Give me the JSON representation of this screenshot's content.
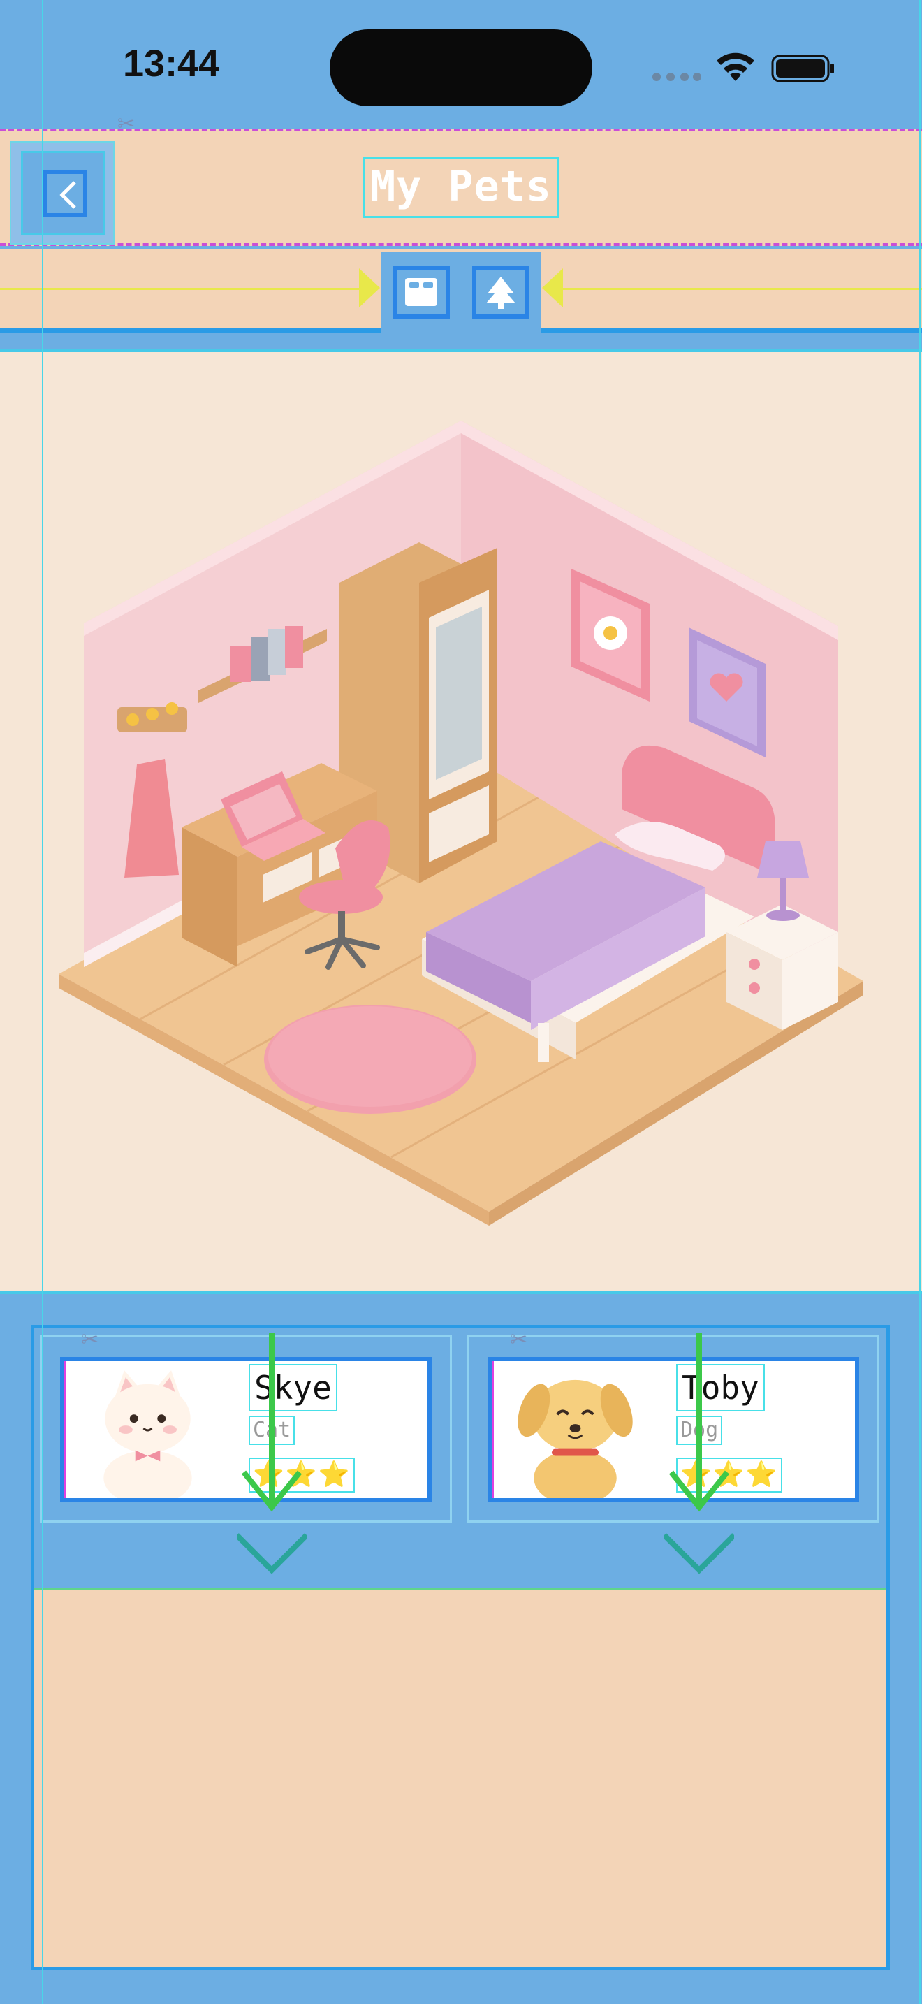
{
  "status_bar": {
    "time": "13:44"
  },
  "header": {
    "title": "My Pets",
    "back_label": "<"
  },
  "modes": [
    {
      "name": "bed",
      "icon": "bed-icon"
    },
    {
      "name": "outdoor",
      "icon": "tree-icon"
    }
  ],
  "room": {
    "icon": "room-illustration"
  },
  "pets": [
    {
      "name": "Skye",
      "species": "Cat",
      "stars": "⭐⭐⭐",
      "rating": 3
    },
    {
      "name": "Toby",
      "species": "Dog",
      "stars": "⭐⭐⭐",
      "rating": 3
    }
  ],
  "colors": {
    "background_blue": "#6caee3",
    "panel_peach": "#f3d4b7",
    "room_bg": "#f6e6d6",
    "accent_blue": "#2a84e6",
    "guide_cyan": "#48e0e8",
    "arrow_green": "#3cc84a"
  }
}
